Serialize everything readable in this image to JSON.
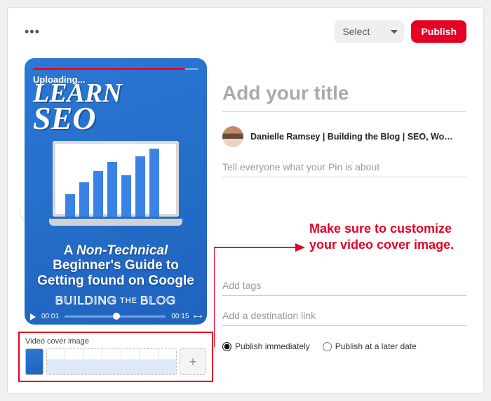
{
  "header": {
    "select_placeholder": "Select",
    "publish_label": "Publish"
  },
  "preview": {
    "status": "Uploading...",
    "headline_line1": "LEARN",
    "headline_line2": "SEO",
    "subtitle_prefix": "A ",
    "subtitle_emphasis": "Non-Technical",
    "subtitle_rest": " Beginner's Guide to Getting found on Google",
    "brand_word1": "BUILDING",
    "brand_word2": "THE",
    "brand_word3": "BLOG",
    "time_current": "00:01",
    "time_total": "00:15"
  },
  "cover": {
    "label": "Video cover image"
  },
  "form": {
    "title_placeholder": "Add your title",
    "title_value": "",
    "author_name": "Danielle Ramsey | Building the Blog | SEO, Wordpress & B...",
    "desc_placeholder": "Tell everyone what your Pin is about",
    "desc_value": "",
    "tags_placeholder": "Add tags",
    "tags_value": "",
    "dest_placeholder": "Add a destination link",
    "dest_value": "",
    "publish_now_label": "Publish immediately",
    "publish_later_label": "Publish at a later date",
    "publish_option": "now"
  },
  "annotation": {
    "text": "Make sure to customize your video cover image."
  }
}
